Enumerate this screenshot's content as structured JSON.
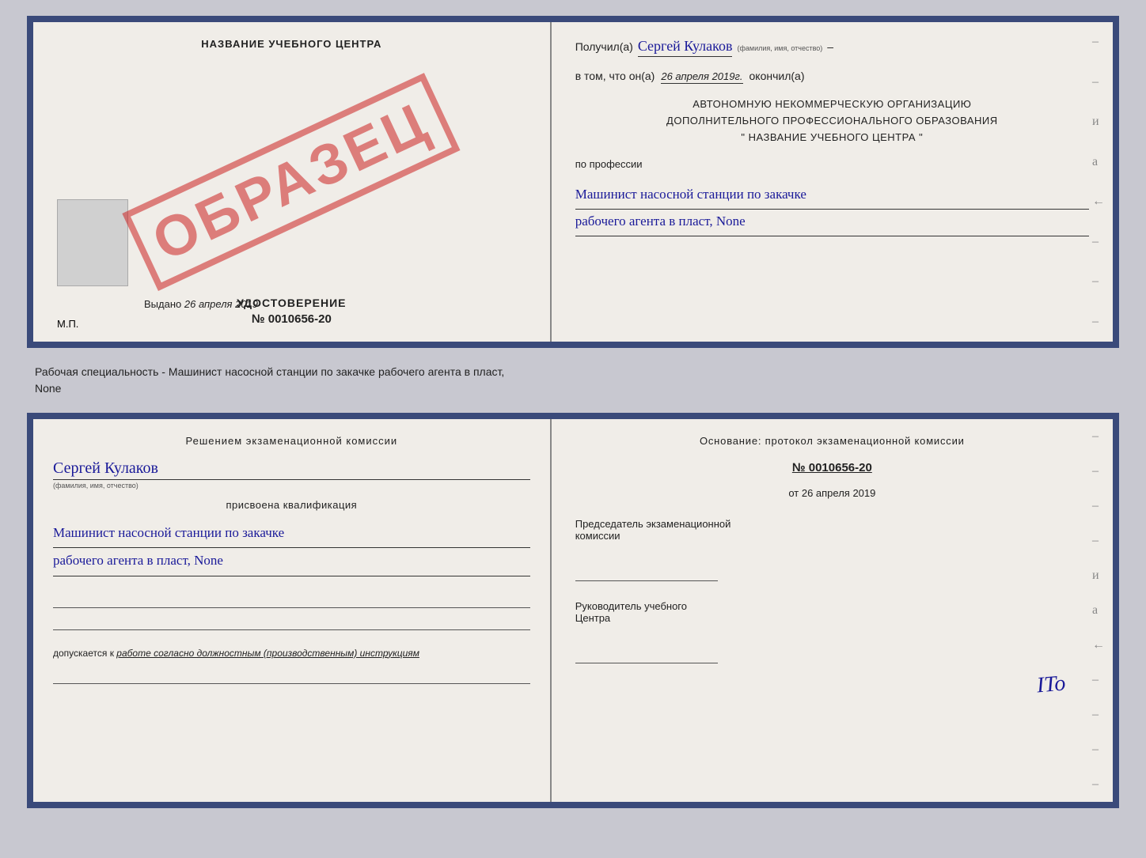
{
  "top_doc": {
    "left": {
      "center_title": "НАЗВАНИЕ УЧЕБНОГО ЦЕНТРА",
      "obrazec": "ОБРАЗЕЦ",
      "udostoverenie_title": "УДОСТОВЕРЕНИЕ",
      "udostoverenie_num": "№ 0010656-20",
      "vydano_label": "Выдано",
      "vydano_date": "26 апреля 2019",
      "mp_label": "М.П."
    },
    "right": {
      "poluchil_label": "Получил(а)",
      "recipient_name": "Сергей Кулаков",
      "name_hint": "(фамилия, имя, отчество)",
      "vtom_label": "в том, что он(а)",
      "date": "26 апреля 2019г.",
      "okonchil_label": "окончил(а)",
      "org_line1": "АВТОНОМНУЮ НЕКОММЕРЧЕСКУЮ ОРГАНИЗАЦИЮ",
      "org_line2": "ДОПОЛНИТЕЛЬНОГО ПРОФЕССИОНАЛЬНОГО ОБРАЗОВАНИЯ",
      "org_line3": "\"   НАЗВАНИЕ УЧЕБНОГО ЦЕНТРА   \"",
      "po_professii": "по профессии",
      "profession_line1": "Машинист насосной станции по закачке",
      "profession_line2": "рабочего агента в пласт, None"
    }
  },
  "between": {
    "text_line1": "Рабочая специальность - Машинист насосной станции по закачке рабочего агента в пласт,",
    "text_line2": "None"
  },
  "bottom_doc": {
    "left": {
      "resheniem_text": "Решением  экзаменационной  комиссии",
      "name": "Сергей Кулаков",
      "name_hint": "(фамилия, имя, отчество)",
      "prisvoyena": "присвоена квалификация",
      "qual_line1": "Машинист насосной станции по закачке",
      "qual_line2": "рабочего агента в пласт, None",
      "dopuskaetsya": "допускается к",
      "dopusk_underline": "работе согласно должностным (производственным) инструкциям"
    },
    "right": {
      "osnovanie": "Основание: протокол экзаменационной комиссии",
      "protocol_num": "№  0010656-20",
      "ot_label": "от",
      "ot_date": "26 апреля 2019",
      "predsedatel_line1": "Председатель экзаменационной",
      "predsedatel_line2": "комиссии",
      "rukovoditel_line1": "Руководитель учебного",
      "rukovoditel_line2": "Центра",
      "ito_mark": "ITo"
    }
  }
}
